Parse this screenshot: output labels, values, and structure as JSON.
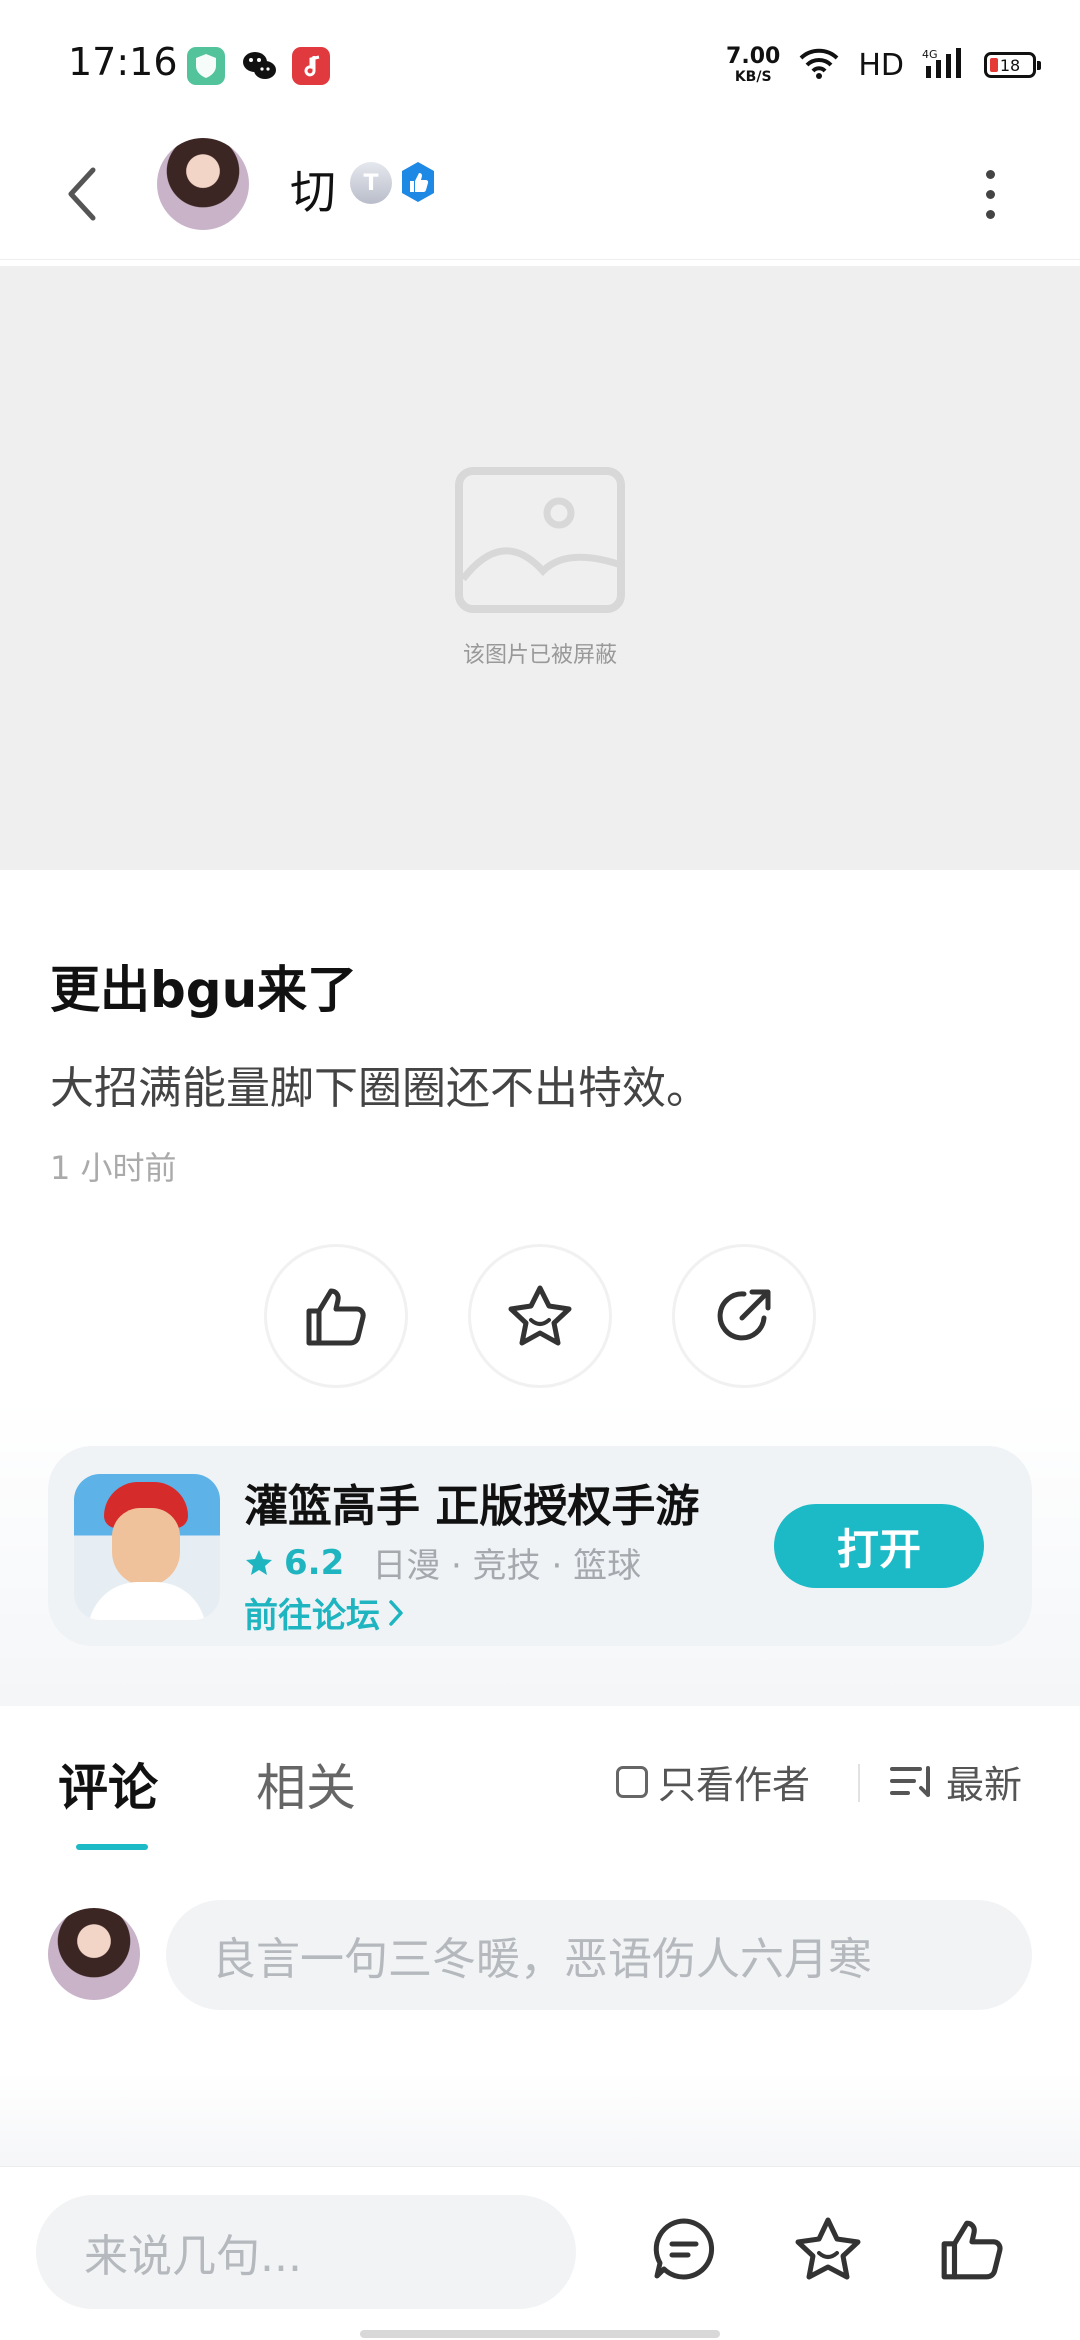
{
  "status_bar": {
    "time": "17:16",
    "net_speed_value": "7.00",
    "net_speed_unit": "KB/S",
    "hd": "HD",
    "battery": "18",
    "apps": [
      "green-shield-app-icon",
      "wechat-icon",
      "music-app-icon"
    ]
  },
  "header": {
    "username": "切",
    "level_badge": "T",
    "more_icon": "more-vertical-icon"
  },
  "blocked_image": {
    "text": "该图片已被屏蔽"
  },
  "post": {
    "title": "更出bgu来了",
    "body": "大招满能量脚下圈圈还不出特效。",
    "time": "1 小时前"
  },
  "game": {
    "name": "灌篮高手 正版授权手游",
    "rating": "6.2",
    "tags": "日漫 · 竞技 · 篮球",
    "forum_link": "前往论坛",
    "open_button": "打开"
  },
  "tabs": {
    "comments": "评论",
    "related": "相关",
    "author_only": "只看作者",
    "sort": "最新"
  },
  "comment_box": {
    "placeholder": "良言一句三冬暖，恶语伤人六月寒"
  },
  "bottom_bar": {
    "placeholder": "来说几句..."
  },
  "colors": {
    "accent": "#1cbac6",
    "blocked_background": "#efefef",
    "verified": "#1e88e5"
  }
}
